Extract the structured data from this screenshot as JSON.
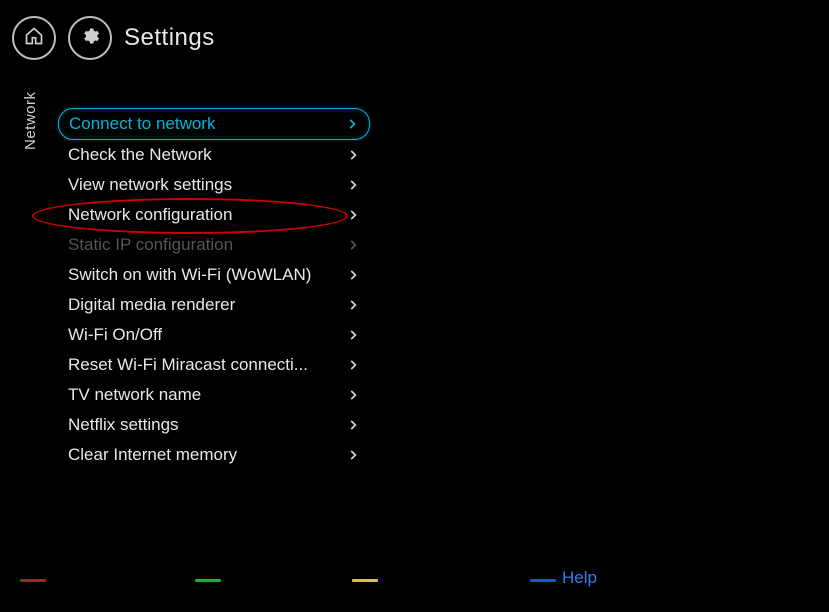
{
  "header": {
    "title": "Settings"
  },
  "side_label": "Network",
  "menu": {
    "items": [
      {
        "label": "Connect to network",
        "state": "selected"
      },
      {
        "label": "Check the Network",
        "state": "normal"
      },
      {
        "label": "View network settings",
        "state": "normal"
      },
      {
        "label": "Network configuration",
        "state": "normal",
        "annotated": true
      },
      {
        "label": "Static IP configuration",
        "state": "disabled"
      },
      {
        "label": "Switch on with Wi-Fi (WoWLAN)",
        "state": "normal"
      },
      {
        "label": "Digital media renderer",
        "state": "normal"
      },
      {
        "label": "Wi-Fi On/Off",
        "state": "normal"
      },
      {
        "label": "Reset Wi-Fi Miracast connecti...",
        "state": "normal"
      },
      {
        "label": "TV network name",
        "state": "normal"
      },
      {
        "label": "Netflix settings",
        "state": "normal"
      },
      {
        "label": "Clear Internet memory",
        "state": "normal"
      }
    ]
  },
  "bottom": {
    "help": "Help"
  }
}
